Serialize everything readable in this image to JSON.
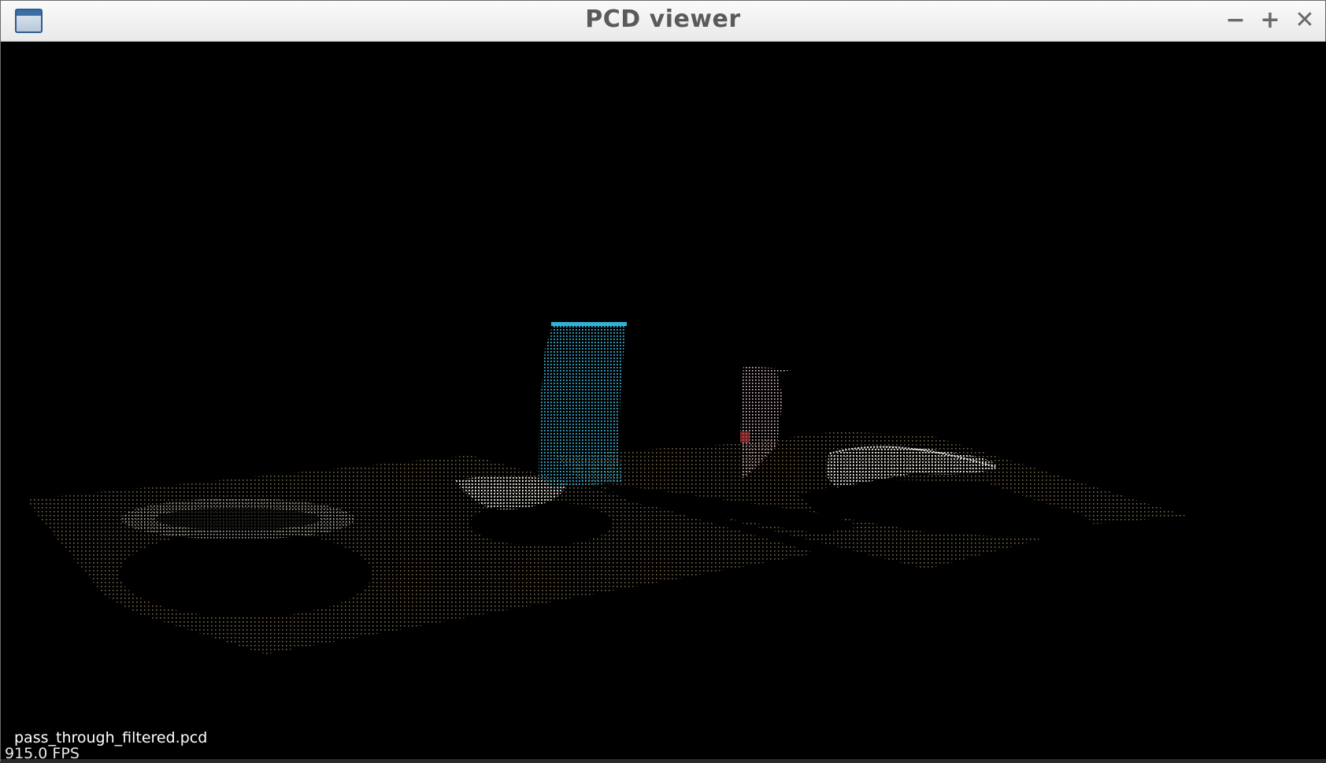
{
  "window": {
    "title": "PCD viewer",
    "icon": "window-icon",
    "controls": {
      "minimize": "−",
      "maximize": "+",
      "close": "✕"
    }
  },
  "viewer": {
    "background": "#000000",
    "cloud_filename": "pass_through_filtered.pcd",
    "fps": "915.0 FPS"
  },
  "colors": {
    "table_points": "#8a7450",
    "object_white": "#f2f2f2",
    "object_cyan": "#2fb4d8",
    "object_pink": "#e8b8c8"
  }
}
